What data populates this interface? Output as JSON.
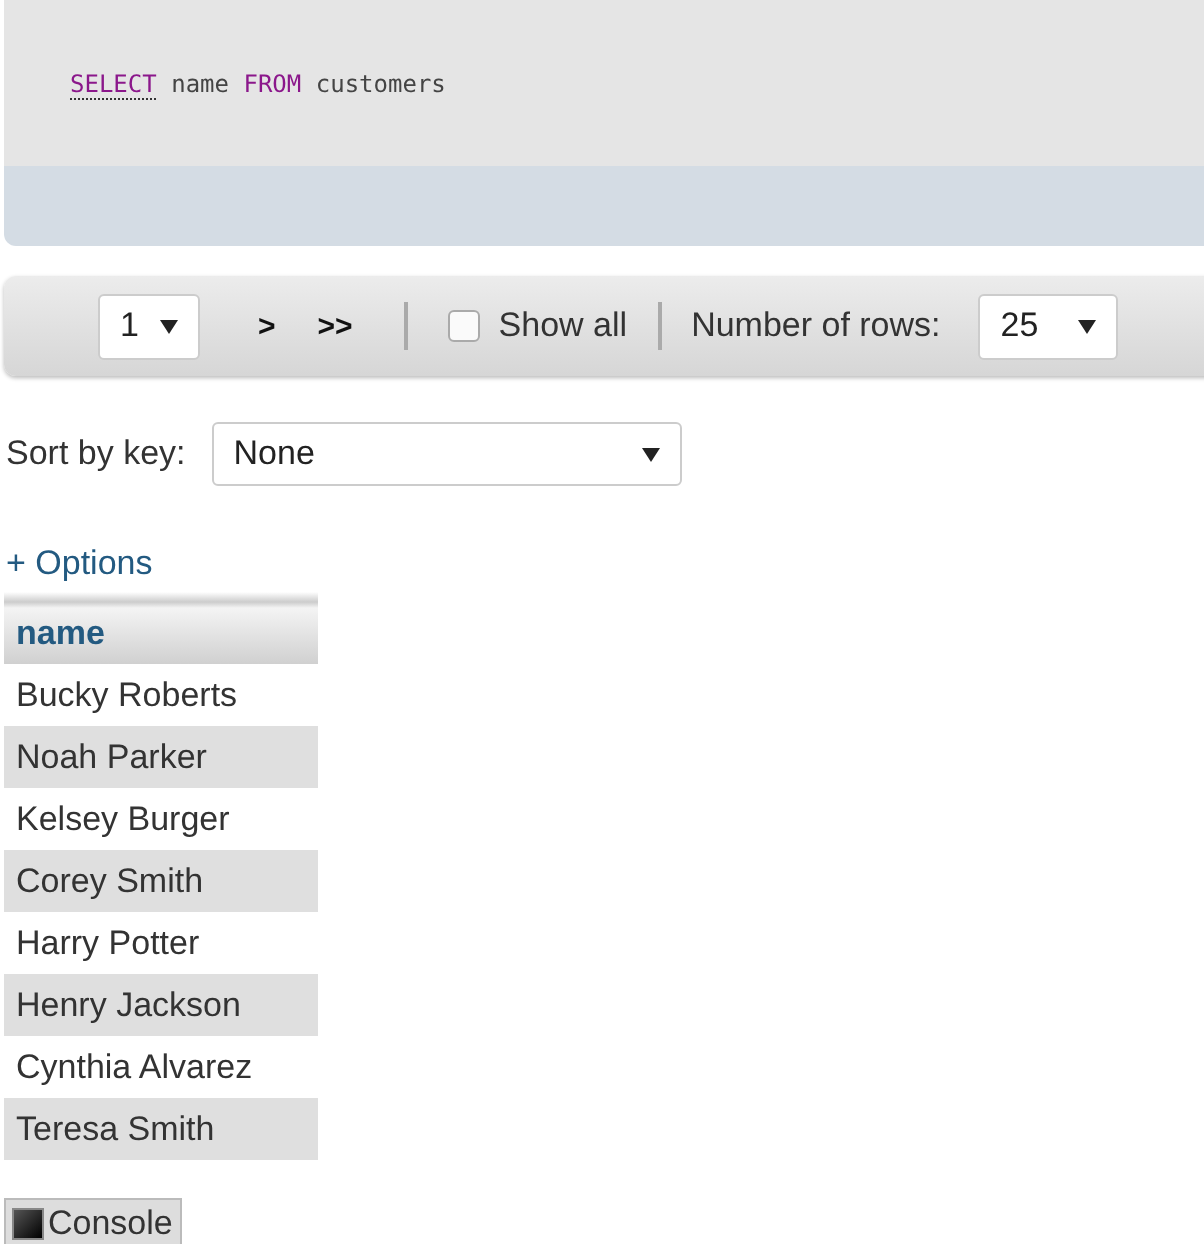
{
  "sql_query": {
    "tokens": [
      {
        "text": "SELECT",
        "kind": "keyword",
        "link": true
      },
      {
        "text": "name",
        "kind": "plain",
        "link": false
      },
      {
        "text": "FROM",
        "kind": "keyword",
        "link": false
      },
      {
        "text": "customers",
        "kind": "plain",
        "link": false
      }
    ]
  },
  "navigation": {
    "page": "1",
    "next": ">",
    "last": ">>",
    "show_all": {
      "label": "Show all",
      "checked": false
    },
    "rows_label": "Number of rows:",
    "rows_value": "25"
  },
  "sort": {
    "label": "Sort by key:",
    "value": "None"
  },
  "options_link": "+ Options",
  "table": {
    "columns": [
      "name"
    ],
    "rows": [
      [
        "Bucky Roberts"
      ],
      [
        "Noah Parker"
      ],
      [
        "Kelsey Burger"
      ],
      [
        "Corey Smith"
      ],
      [
        "Harry Potter"
      ],
      [
        "Henry Jackson"
      ],
      [
        "Cynthia Alvarez"
      ],
      [
        "Teresa Smith"
      ]
    ]
  },
  "console": {
    "label": "Console"
  }
}
